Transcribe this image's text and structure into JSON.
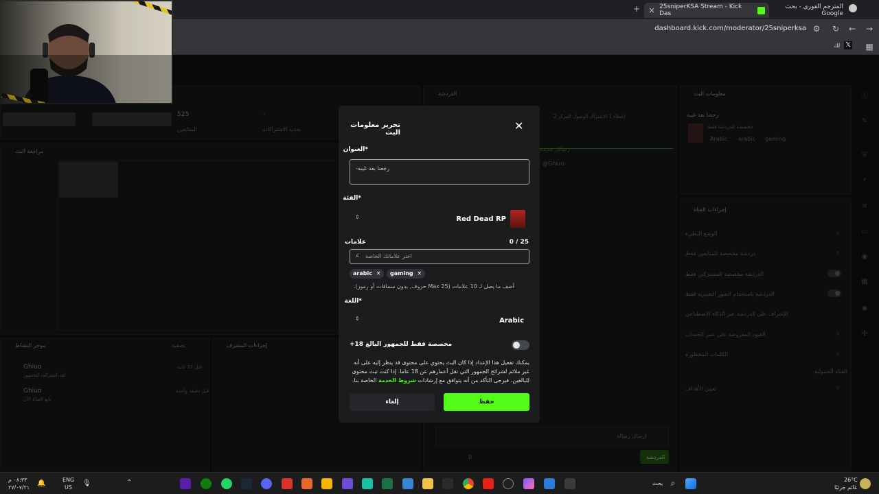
{
  "browser": {
    "tabs": [
      {
        "label": "المترجم الفوري - بحث Google"
      },
      {
        "label": "25sniperKSA Stream - Kick Das"
      }
    ],
    "url": "dashboard.kick.com/moderator/25sniperksa",
    "bookmark_label": "لك"
  },
  "dashboard": {
    "stats": [
      {
        "value": "525",
        "label": "المتابعين"
      },
      {
        "value": "-",
        "label": "تحديد الاشتراكات"
      }
    ],
    "preview_title": "مراجعة البث",
    "chat_title": "الدردشة",
    "chat_notice": "إعطاء 1 الاشتراك الوصول المركز 2",
    "chat_user": "@Ghiuo",
    "chat_tab": "رسائل جديدة",
    "chat_input_placeholder": "إرسال رسالة",
    "chat_button": "الدردشة",
    "chat_count": "0",
    "stream_info": {
      "title": "معلومات البث",
      "stream_title": "رجعنا بعد غيبه",
      "subtitle": "مخصصة للدردشة فقط",
      "tags": [
        "Arabic",
        "arabic",
        "gaming"
      ]
    },
    "channel_actions": {
      "title": "إجراءات القناة",
      "items": [
        "الوضع البطيء",
        "دردشة مخصصة للمتابعين فقط",
        "الدردشة مخصصة للمشتركين فقط",
        "الدردشة باستخدام الصور التعبيرية فقط",
        "الإشراف على الدردشة عبر الذكاء الاصطناعي",
        "القيود المفروضة على عمر الحساب",
        "الكلمات المحظورة"
      ],
      "section": "القناة الخمولية",
      "goals": "تعيين الأهداف"
    },
    "activity": {
      "title": "موجز النشاط",
      "filter": "تصفية",
      "items": [
        {
          "user": "Ghiuo",
          "text": "لقد اشتركت للجمهور",
          "time": "قبل 37 ثانية"
        },
        {
          "user": "Ghiuo",
          "text": "تابع القناة الآن",
          "time": "قبل دقيقة واحدة"
        }
      ]
    },
    "mod_actions_title": "إجراءات المشرف"
  },
  "modal": {
    "title": "تحرير معلومات البث",
    "title_label": "*العنوان",
    "title_value": "رجعنا بعد غيبه-",
    "category_label": "*الفئة",
    "category_value": "Red Dead RP",
    "tags_label": "علامات",
    "tags_count": "0 / 25",
    "tags_placeholder": "اختر علاماتك الخاصة",
    "tags": [
      {
        "label": "arabic"
      },
      {
        "label": "gaming"
      }
    ],
    "tags_hint": "أضف ما يصل لـ 10 علامات (Max 25 حروف, بدون مسافات أو رموز).",
    "language_label": "*اللغة",
    "language_value": "Arabic",
    "adult_label": "+مخصصة فقط للجمهور البالغ 18",
    "adult_enabled": false,
    "note_text": "يمكنك تفعيل هذا الإعداد إذا كان البث يحتوي على محتوى قد ينظر إليه على أنه غير ملائم لشرائح الجمهور التي تقل أعمارهم عن 18 عاما. إذا كنت تبث محتوى للبالغين، فيرجى التأكد من أنه يتوافق مع إرشادات",
    "note_link": "شروط الخدمة",
    "note_tail": "الخاصة بنا.",
    "cancel_label": "إلغاء",
    "save_label": "حفظ",
    "accent_color": "#53fc18"
  },
  "taskbar": {
    "time": "٠٨:٣٣ م",
    "date": "٢٧/٠٧/٢١",
    "lang_top": "ENG",
    "lang_bottom": "US",
    "search_placeholder": "بحث",
    "weather_temp": "26°C",
    "weather_desc": "غائم جزئيًا"
  }
}
